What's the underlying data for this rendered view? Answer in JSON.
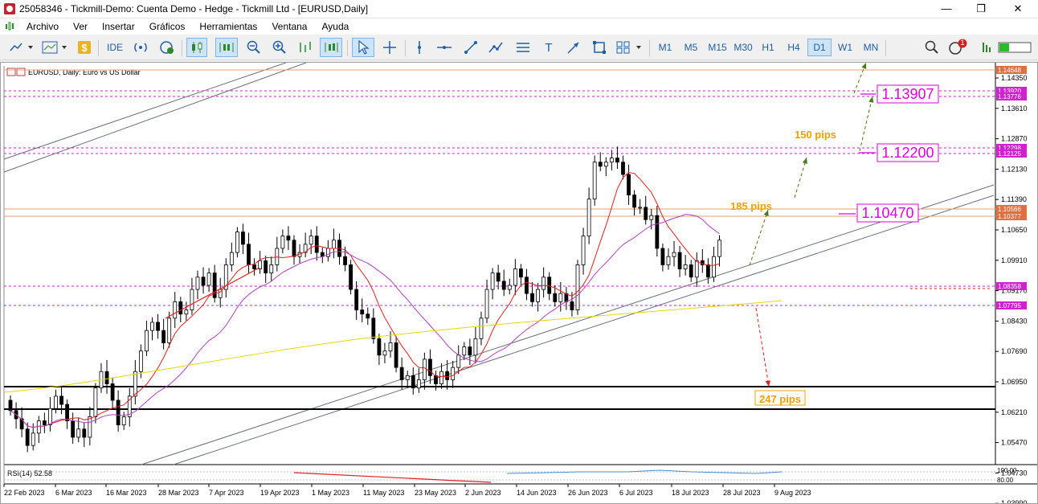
{
  "window": {
    "title": "25058346 - Tickmill-Demo: Cuenta Demo - Hedge - Tickmill Ltd - [EURUSD,Daily]",
    "minimize": "—",
    "maximize": "❐",
    "close": "✕"
  },
  "menu": [
    "Archivo",
    "Ver",
    "Insertar",
    "Gráficos",
    "Herramientas",
    "Ventana",
    "Ayuda"
  ],
  "toolbar": {
    "ide": "IDE",
    "timeframes": [
      "M1",
      "M5",
      "M15",
      "M30",
      "H1",
      "H4",
      "D1",
      "W1",
      "MN"
    ],
    "active_timeframe": "D1",
    "notification_count": "1"
  },
  "chart": {
    "label": "EURUSD, Daily:  Euro vs US Dollar",
    "rsi_label": "RSI(14) 52.58",
    "rsi_ticks": [
      "100.00",
      "80.00"
    ],
    "price_ticks": [
      "1.14350",
      "1.13610",
      "1.12870",
      "1.12130",
      "1.11390",
      "1.10650",
      "1.09910",
      "1.09170",
      "1.08430",
      "1.07690",
      "1.06950",
      "1.06210",
      "1.05470",
      "1.04730",
      "1.03990"
    ],
    "date_ticks": [
      "22 Feb 2023",
      "6 Mar 2023",
      "16 Mar 2023",
      "28 Mar 2023",
      "7 Apr 2023",
      "19 Apr 2023",
      "1 May 2023",
      "11 May 2023",
      "23 May 2023",
      "2 Jun 2023",
      "14 Jun 2023",
      "26 Jun 2023",
      "6 Jul 2023",
      "18 Jul 2023",
      "28 Jul 2023",
      "9 Aug 2023"
    ],
    "level_tags": [
      "1.14648",
      "1.13920",
      "1.13776",
      "1.12298",
      "1.12125",
      "1.10566",
      "1.10377",
      "1.08358",
      "1.07795"
    ],
    "targets": [
      "1.13907",
      "1.12200",
      "1.10470"
    ],
    "annotations": {
      "pips_150": "150 pips",
      "pips_185": "185 pips",
      "pips_247": "247 pips"
    },
    "colors": {
      "bull_candle": "#ffffff",
      "bear_candle": "#000000",
      "ma_fast": "#e02020",
      "ma_mid": "#b040c0",
      "ma_slow": "#e8d800",
      "target_box": "#e000e0",
      "pips_text": "#f0a000",
      "arrow_up": "#4a7a1a",
      "arrow_down": "#e02020"
    }
  }
}
